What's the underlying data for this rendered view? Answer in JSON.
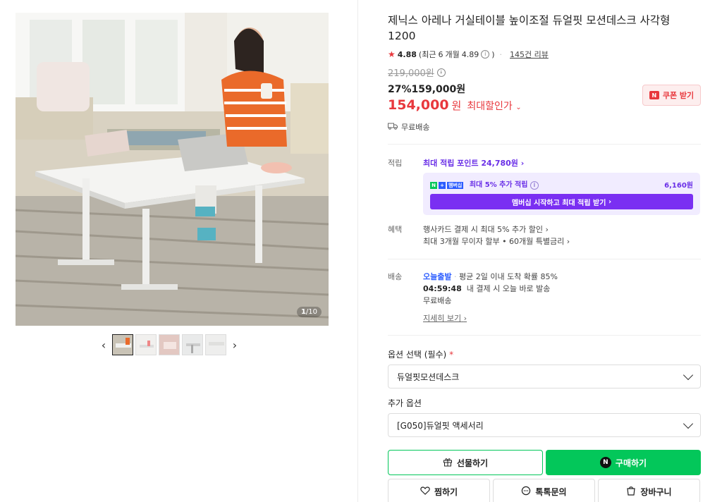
{
  "product": {
    "title": "제닉스 아레나 거실테이블 높이조절 듀얼핏 모션데스크 사각형 1200",
    "image_counter_current": "1",
    "image_counter_total": "/10"
  },
  "rating": {
    "score": "4.88",
    "recent_prefix": "(최근",
    "recent_months": "6",
    "recent_mid": "개월",
    "recent_score": "4.89",
    "recent_suffix": ")",
    "review_count_label": "145건 리뷰"
  },
  "price": {
    "original": "219,000원",
    "discount_label": "27%159,000원",
    "final_number": "154,000",
    "final_unit": "원",
    "max_discount_label": "최대할인가",
    "coupon_button": "쿠폰 받기",
    "shipping": "무료배송"
  },
  "points": {
    "label": "적립",
    "max_point_link": "최대 적립 포인트 24,780원",
    "member_text": "최대 5% 추가 적립",
    "member_badge": "멤버십",
    "member_amount": "6,160원",
    "member_button": "멤버십 시작하고 최대 적립 받기"
  },
  "benefit": {
    "label": "혜택",
    "line1": "행사카드 결제 시 최대 5% 추가 할인",
    "line2": "최대 3개월 무이자 할부 • 60개월 특별금리"
  },
  "delivery": {
    "label": "배송",
    "today": "오늘출발",
    "avg_text": "평균 2일 이내 도착 확률 85%",
    "time": "04:59:48",
    "time_text": "내 결제 시 오늘 바로 발송",
    "free": "무료배송",
    "detail_link": "지세히 보기"
  },
  "options": {
    "required_label": "옵션 선택 (필수)",
    "required_mark": "*",
    "required_value": "듀얼핏모션데스크",
    "extra_label": "추가 옵션",
    "extra_value": "[G050]듀얼핏 액세서리"
  },
  "actions": {
    "gift": "선물하기",
    "buy": "구매하기",
    "wish": "찜하기",
    "talk": "톡톡문의",
    "cart": "장바구니"
  },
  "colors": {
    "accent_red": "#e8383d",
    "naver_green": "#03c75a",
    "membership_purple": "#7a2ff2"
  }
}
